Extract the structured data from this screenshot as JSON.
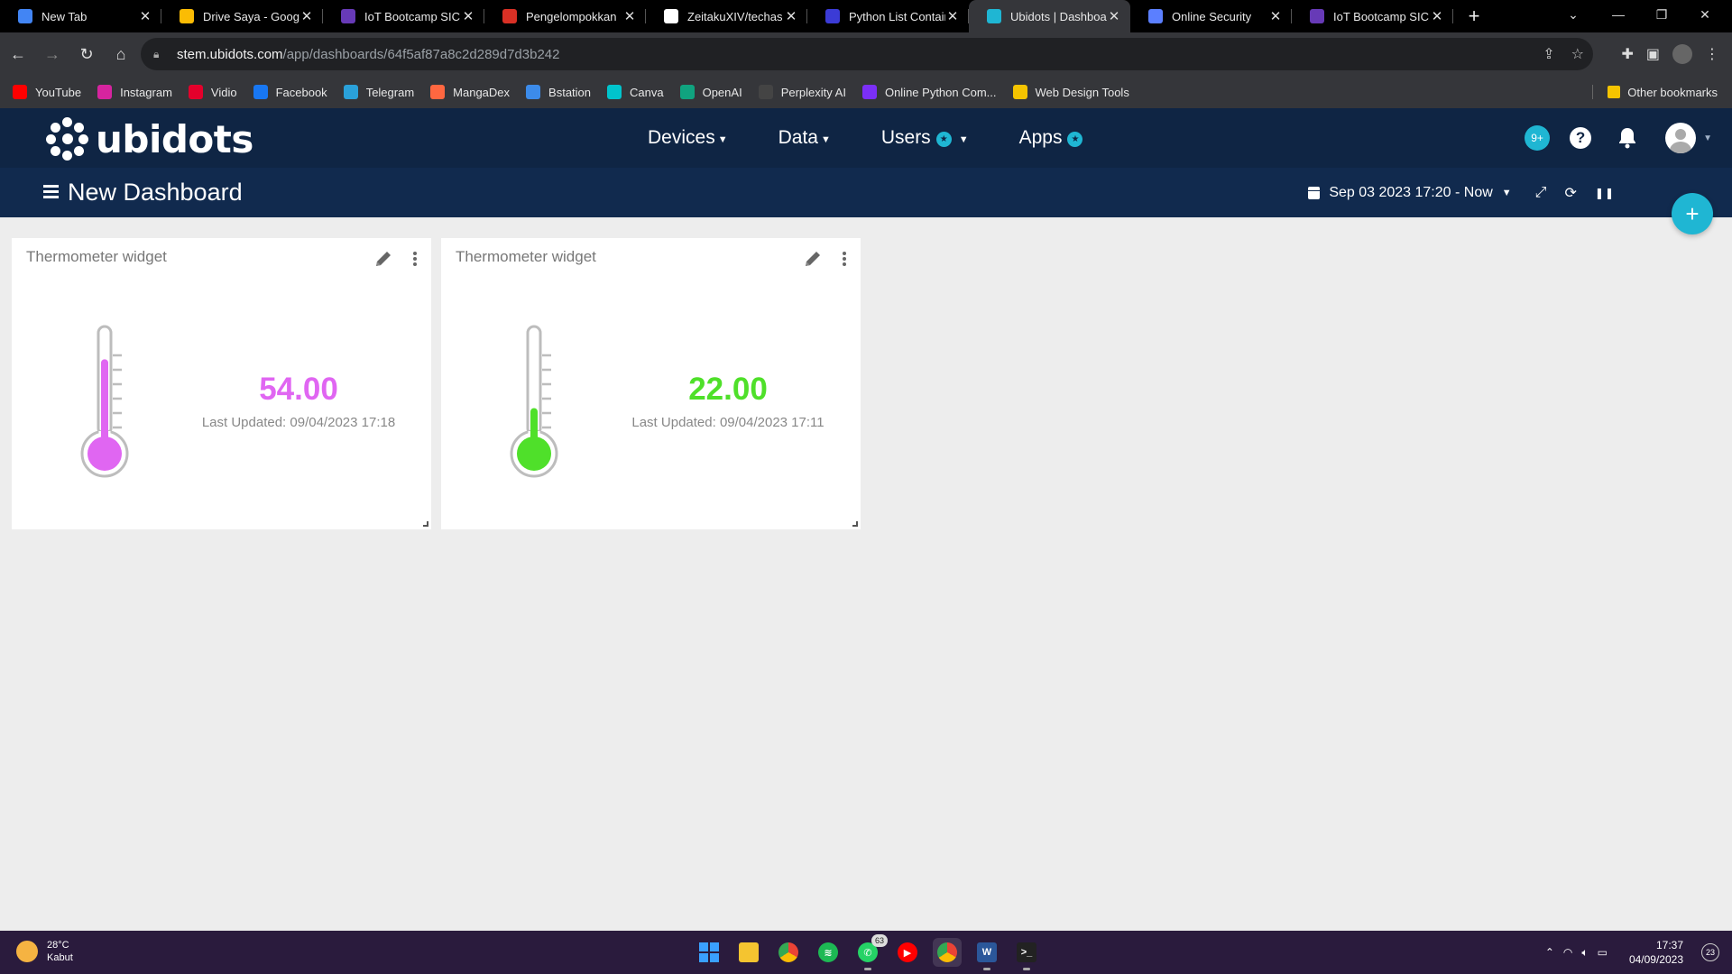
{
  "browser": {
    "tabs": [
      {
        "title": "New Tab",
        "icon": "chrome-icon",
        "color": "#4285f4",
        "active": false
      },
      {
        "title": "Drive Saya - Googl",
        "icon": "drive-icon",
        "color": "#fbbc04",
        "active": false
      },
      {
        "title": "IoT Bootcamp SIC",
        "icon": "forms-icon",
        "color": "#673ab7",
        "active": false
      },
      {
        "title": "Pengelompokkan",
        "icon": "slides-icon",
        "color": "#d93025",
        "active": false
      },
      {
        "title": "ZeitakuXIV/techas",
        "icon": "github-icon",
        "color": "#ffffff",
        "active": false
      },
      {
        "title": "Python List Contain",
        "icon": "site-icon",
        "color": "#3b3bd6",
        "active": false
      },
      {
        "title": "Ubidots | Dashboa",
        "icon": "ubidots-icon",
        "color": "#1fb6d3",
        "active": true
      },
      {
        "title": "Online Security",
        "icon": "shield-icon",
        "color": "#5b7fff",
        "active": false
      },
      {
        "title": "IoT Bootcamp SIC",
        "icon": "forms-icon",
        "color": "#673ab7",
        "active": false
      }
    ],
    "url_host": "stem.ubidots.com",
    "url_path": "/app/dashboards/64f5af87a8c2d289d7d3b242",
    "bookmarks": [
      {
        "label": "YouTube",
        "color": "#ff0000"
      },
      {
        "label": "Instagram",
        "color": "#d6249f"
      },
      {
        "label": "Vidio",
        "color": "#e4002b"
      },
      {
        "label": "Facebook",
        "color": "#1877f2"
      },
      {
        "label": "Telegram",
        "color": "#2aa1da"
      },
      {
        "label": "MangaDex",
        "color": "#ff6740"
      },
      {
        "label": "Bstation",
        "color": "#3c8bea"
      },
      {
        "label": "Canva",
        "color": "#00c4cc"
      },
      {
        "label": "OpenAI",
        "color": "#10a37f"
      },
      {
        "label": "Perplexity AI",
        "color": "#444444"
      },
      {
        "label": "Online Python Com...",
        "color": "#7b2ff7"
      },
      {
        "label": "Web Design Tools",
        "color": "#f5c400"
      }
    ],
    "other_bookmarks": "Other bookmarks"
  },
  "ubidots": {
    "logo_text": "ubidots",
    "nav": {
      "devices": "Devices",
      "data": "Data",
      "users": "Users",
      "apps": "Apps"
    },
    "notification_badge": "9+",
    "help": "?"
  },
  "dashboard": {
    "title": "New Dashboard",
    "time_range": "Sep 03 2023 17:20 - Now"
  },
  "widgets": [
    {
      "title": "Thermometer widget",
      "value": "54.00",
      "updated": "Last Updated: 09/04/2023 17:18",
      "color": "#e066f2",
      "level": 0.77
    },
    {
      "title": "Thermometer widget",
      "value": "22.00",
      "updated": "Last Updated: 09/04/2023 17:11",
      "color": "#4fe02a",
      "level": 0.36
    }
  ],
  "taskbar": {
    "temperature": "28°C",
    "weather": "Kabut",
    "whatsapp_badge": "63",
    "time": "17:37",
    "date": "04/09/2023",
    "notifications": "23"
  },
  "colors": {
    "header_bg": "#0f2544",
    "dashbar_bg": "#112a4e",
    "accent": "#1fb6d3"
  }
}
